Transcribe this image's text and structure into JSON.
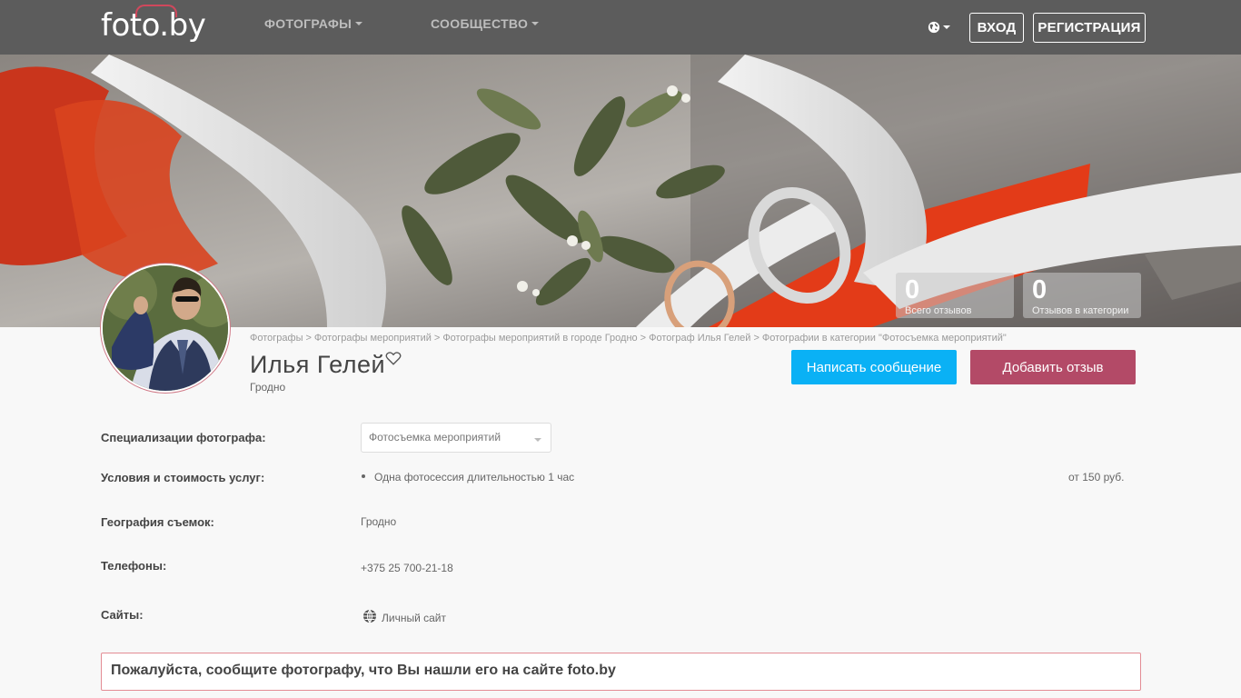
{
  "header": {
    "logo": "foto.by",
    "nav": [
      {
        "label": "ФОТОГРАФЫ"
      },
      {
        "label": "СООБЩЕСТВО"
      }
    ],
    "login_label": "ВХОД",
    "register_label": "РЕГИСТРАЦИЯ",
    "language_icon": "globe-icon"
  },
  "stats": [
    {
      "value": "0",
      "label": "Всего отзывов"
    },
    {
      "value": "0",
      "label": "Отзывов в категории"
    }
  ],
  "breadcrumb": [
    "Фотографы",
    "Фотографы мероприятий",
    "Фотографы мероприятий в городе Гродно",
    "Фотограф Илья Гелей",
    "Фотографии в категории \"Фотосъемка мероприятий\""
  ],
  "breadcrumb_separator": ">",
  "profile": {
    "name": "Илья Гелей",
    "city": "Гродно",
    "message_button": "Написать сообщение",
    "review_button": "Добавить отзыв"
  },
  "info": {
    "specializations_label": "Специализации фотографа:",
    "specialization_selected": "Фотосъемка мероприятий",
    "conditions_label": "Условия и стоимость услуг:",
    "service_name": "Одна фотосессия длительностью 1 час",
    "service_price": "от 150 руб.",
    "geography_label": "География съемок:",
    "geography_value": "Гродно",
    "phones_label": "Телефоны:",
    "phone_value": "+375 25 700-21-18",
    "sites_label": "Сайты:",
    "site_value": "Личный сайт"
  },
  "notice": "Пожалуйста, сообщите фотографу, что Вы нашли его на сайте foto.by",
  "colors": {
    "header_bg": "#5c5c5c",
    "message_btn": "#0ab1f5",
    "review_btn": "#b34a67",
    "notice_border": "#e38c94"
  }
}
